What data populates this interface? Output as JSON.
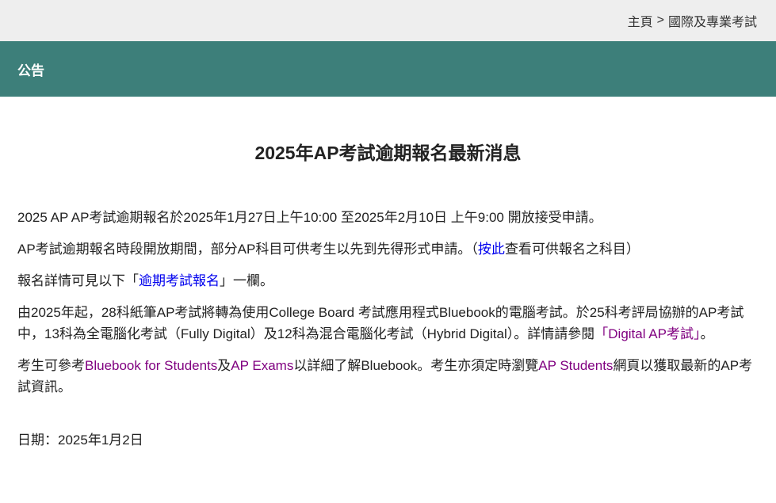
{
  "breadcrumb": {
    "home": "主頁",
    "separator": ">",
    "current": "國際及專業考試"
  },
  "header": {
    "title": "公告"
  },
  "article": {
    "title": "2025年AP考試逾期報名最新消息",
    "p1": "2025 AP AP考試逾期報名於2025年1月27日上午10:00 至2025年2月10日 上午9:00 開放接受申請。",
    "p2_before": "AP考試逾期報名時段開放期間，部分AP科目可供考生以先到先得形式申請。（",
    "p2_link": "按此",
    "p2_after": "查看可供報名之科目）",
    "p3_before": "報名詳情可見以下「",
    "p3_link": "逾期考試報名",
    "p3_after": "」一欄。",
    "p4_before": "由2025年起，28科紙筆AP考試將轉為使用College Board 考試應用程式Bluebook的電腦考試。於25科考評局協辦的AP考試中，13科為全電腦化考試（Fully Digital）及12科為混合電腦化考試（Hybrid Digital）。詳情請參閱",
    "p4_link": "「Digital AP考試」",
    "p4_after": "。",
    "p5_before": "考生可參考",
    "p5_link1": "Bluebook for Students",
    "p5_mid1": "及",
    "p5_link2": "AP Exams",
    "p5_mid2": "以詳細了解Bluebook。考生亦須定時瀏覽",
    "p5_link3": "AP Students",
    "p5_after": "網頁以獲取最新的AP考試資訊。",
    "date": "日期：2025年1月2日"
  }
}
